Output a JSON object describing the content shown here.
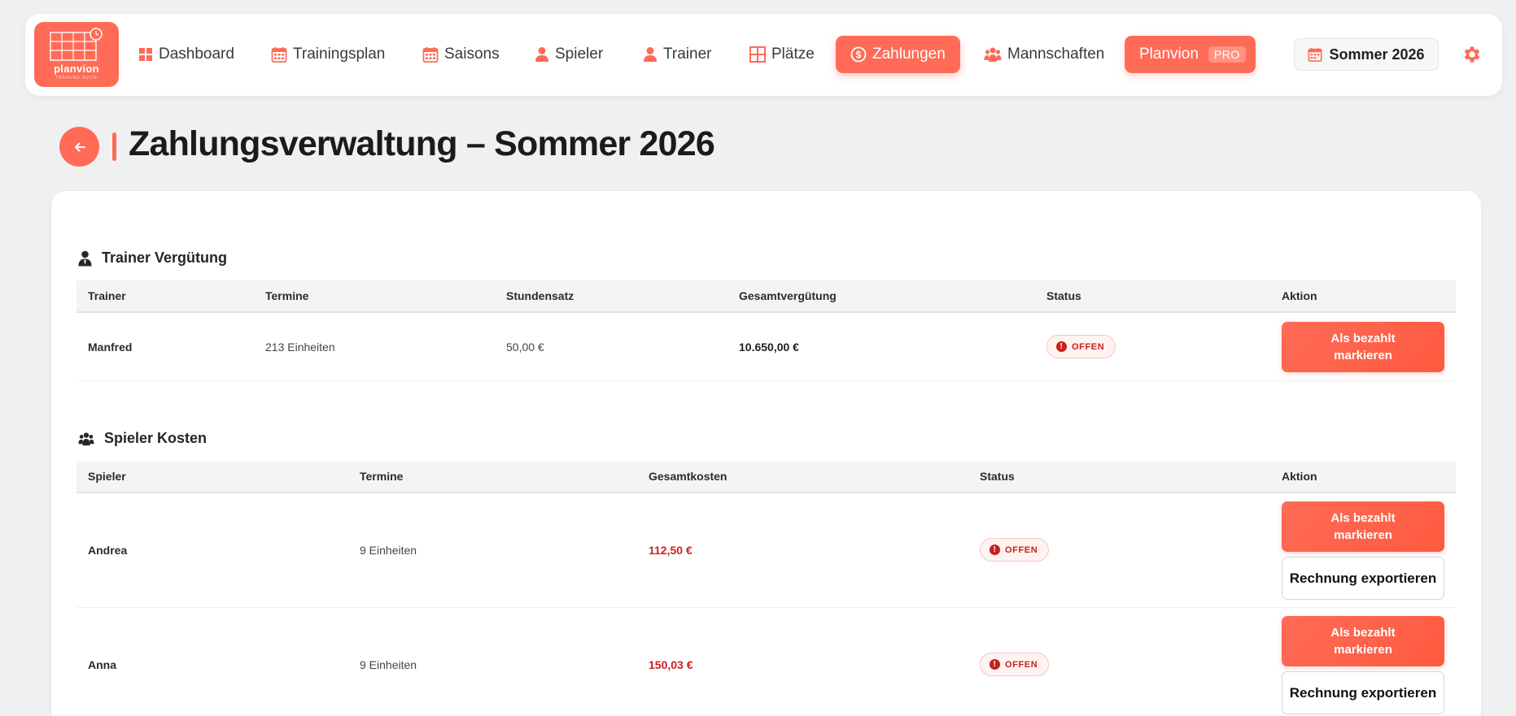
{
  "app": {
    "logo_name": "planvion",
    "logo_sub": "TRAINING SUITE"
  },
  "nav": {
    "items": [
      {
        "label": "Dashboard",
        "icon": "dashboard-icon"
      },
      {
        "label": "Trainingsplan",
        "icon": "calendar-icon"
      },
      {
        "label": "Saisons",
        "icon": "calendar-icon"
      },
      {
        "label": "Spieler",
        "icon": "user-icon"
      },
      {
        "label": "Trainer",
        "icon": "user-icon"
      },
      {
        "label": "Plätze",
        "icon": "grid-icon"
      },
      {
        "label": "Zahlungen",
        "icon": "dollar-circle-icon",
        "active": true
      },
      {
        "label": "Mannschaften",
        "icon": "group-icon"
      }
    ],
    "pro_label": "Planvion",
    "pro_badge": "PRO",
    "season": "Sommer 2026",
    "accent": "#ff6b57"
  },
  "page": {
    "title": "Zahlungsverwaltung – Sommer 2026"
  },
  "trainer_section": {
    "title": "Trainer Vergütung",
    "columns": [
      "Trainer",
      "Termine",
      "Stundensatz",
      "Gesamtvergütung",
      "Status",
      "Aktion"
    ],
    "rows": [
      {
        "trainer": "Manfred",
        "termine": "213 Einheiten",
        "stundensatz": "50,00 €",
        "gesamt": "10.650,00 €",
        "status": "OFFEN",
        "action": "Als bezahlt markieren"
      }
    ]
  },
  "player_section": {
    "title": "Spieler Kosten",
    "columns": [
      "Spieler",
      "Termine",
      "Gesamtkosten",
      "Status",
      "Aktion"
    ],
    "rows": [
      {
        "spieler": "Andrea",
        "termine": "9 Einheiten",
        "kosten": "112,50 €",
        "status": "OFFEN",
        "action": "Als bezahlt markieren",
        "export": "Rechnung exportieren"
      },
      {
        "spieler": "Anna",
        "termine": "9 Einheiten",
        "kosten": "150,03 €",
        "status": "OFFEN",
        "action": "Als bezahlt markieren",
        "export": "Rechnung exportieren"
      }
    ]
  }
}
